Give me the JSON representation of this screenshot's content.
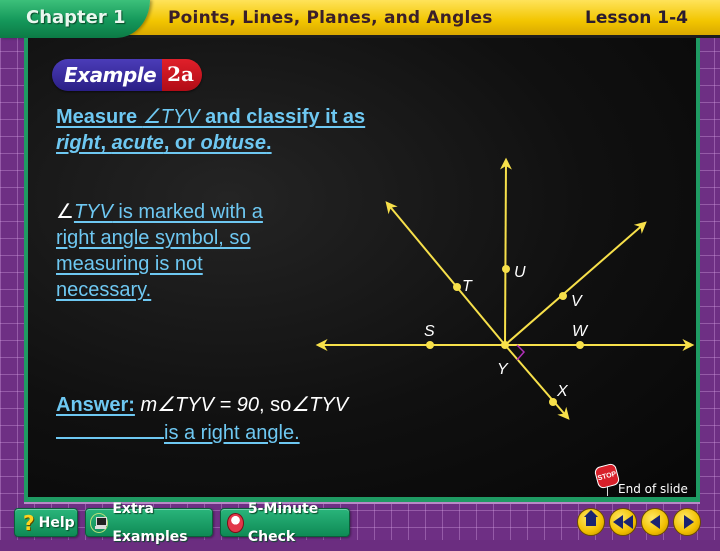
{
  "header": {
    "chapter": "Chapter 1",
    "title": "Points, Lines, Planes, and Angles",
    "lesson": "Lesson 1-4"
  },
  "example": {
    "word": "Example",
    "number": "2a"
  },
  "question": {
    "prefix": "Measure ",
    "angle": "∠TYV",
    "middle": "  and classify it as",
    "options_1": "right",
    "sep_1": ", ",
    "options_2": "acute",
    "sep_2": ", or ",
    "options_3": "obtuse",
    "end": "."
  },
  "explanation": {
    "angle_symbol": "∠",
    "angle_name": "TYV",
    "text": " is marked with a right angle symbol, so measuring is not necessary."
  },
  "answer": {
    "label": "Answer:",
    "math": "m∠TYV = 90",
    "connector": ", so",
    "angle": "∠TYV",
    "conclusion": "is a right angle."
  },
  "diagram": {
    "vertex": "Y",
    "points": [
      "S",
      "T",
      "U",
      "V",
      "W",
      "X",
      "Y"
    ],
    "rays": [
      "YT",
      "YU",
      "YV",
      "YX"
    ],
    "line": "SW",
    "right_angle_marked": "WYX",
    "line_color": "#f7e04a",
    "marker_color": "#b02fb8"
  },
  "end_of_slide": {
    "stop_text": "STOP",
    "label": "End of slide"
  },
  "toolbar": {
    "help": "Help",
    "extra_examples": "Extra Examples",
    "five_minute_check": "5-Minute Check"
  },
  "navigation": [
    "home",
    "first-slide",
    "previous-slide",
    "next-slide"
  ],
  "colors": {
    "header_yellow": "#f2c500",
    "chapter_green": "#14975a",
    "text_blue": "#6ec8f2",
    "frame_green": "#1f9a63",
    "background_purple": "#6e2f84"
  }
}
